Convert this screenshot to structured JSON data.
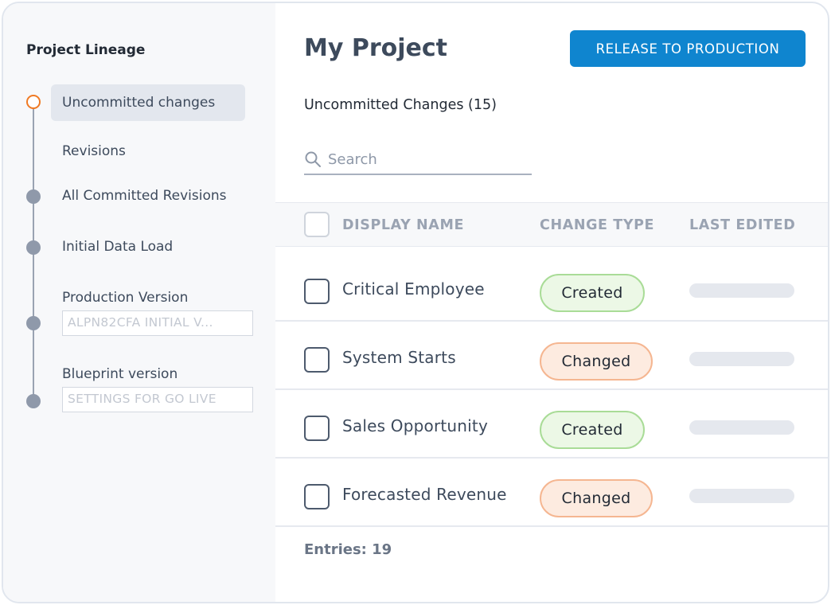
{
  "sidebar": {
    "title": "Project Lineage",
    "items": [
      {
        "label": "Uncommitted changes"
      },
      {
        "label": "Revisions"
      },
      {
        "label": "All Committed Revisions"
      },
      {
        "label": "Initial Data Load"
      },
      {
        "label": "Production Version",
        "version_value": "ALPN82CFA INITIAL V..."
      },
      {
        "label": "Blueprint version",
        "version_value": "SETTINGS FOR GO LIVE"
      }
    ]
  },
  "header": {
    "title": "My Project",
    "release_button": "RELEASE TO PRODUCTION"
  },
  "subtitle": "Uncommitted Changes (15)",
  "search": {
    "placeholder": "Search",
    "value": ""
  },
  "table": {
    "columns": [
      "DISPLAY NAME",
      "CHANGE TYPE",
      "LAST EDITED"
    ],
    "rows": [
      {
        "name": "Critical Employee",
        "change_type": "Created"
      },
      {
        "name": "System Starts",
        "change_type": "Changed"
      },
      {
        "name": "Sales Opportunity",
        "change_type": "Created"
      },
      {
        "name": "Forecasted Revenue",
        "change_type": "Changed"
      }
    ]
  },
  "footer": {
    "entries": "Entries: 19"
  },
  "colors": {
    "accent": "#0f85cf",
    "current_marker": "#f07a24",
    "created_bg": "#ecf8e6",
    "changed_bg": "#fdebe0"
  }
}
